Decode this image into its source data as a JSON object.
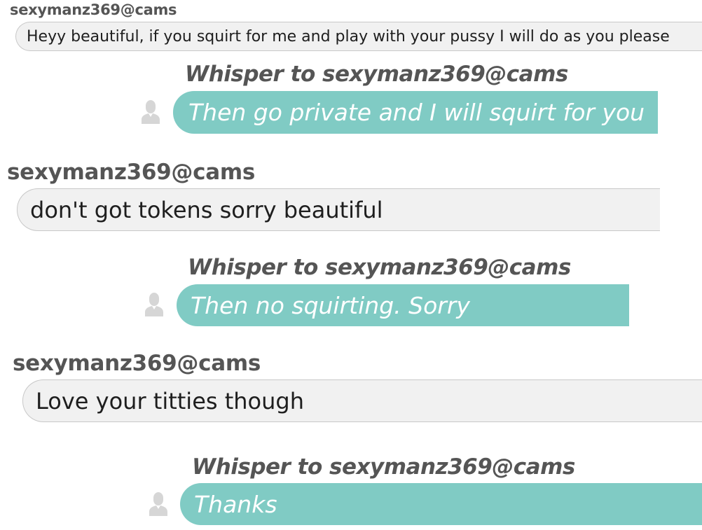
{
  "colors": {
    "whisper_bubble": "#80cbc4",
    "incoming_bubble": "#f1f1f1",
    "name_text": "#555555",
    "avatar_icon": "#d6d6d6"
  },
  "messages": [
    {
      "type": "incoming",
      "sender": "sexymanz369@cams",
      "text": "Heyy beautiful, if you squirt for me and play with your pussy I will do as you please"
    },
    {
      "type": "whisper",
      "title": "Whisper to sexymanz369@cams",
      "text": "Then go private and I will squirt for you",
      "icon": "user-silhouette-icon"
    },
    {
      "type": "incoming",
      "sender": "sexymanz369@cams",
      "text": "don't got tokens sorry beautiful"
    },
    {
      "type": "whisper",
      "title": "Whisper to sexymanz369@cams",
      "text": "Then no squirting. Sorry",
      "icon": "user-silhouette-icon"
    },
    {
      "type": "incoming",
      "sender": "sexymanz369@cams",
      "text": "Love your titties though"
    },
    {
      "type": "whisper",
      "title": "Whisper to sexymanz369@cams",
      "text": "Thanks",
      "icon": "user-silhouette-icon"
    }
  ]
}
